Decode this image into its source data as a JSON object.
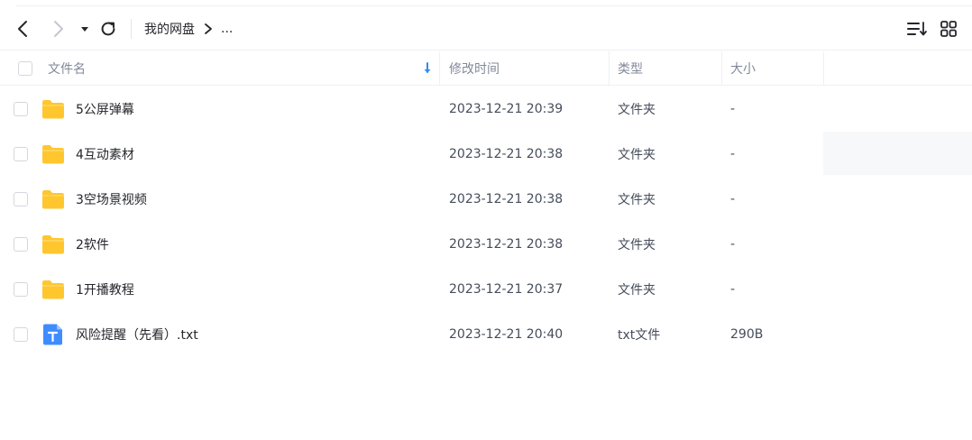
{
  "toolbar": {
    "breadcrumb": {
      "root": "我的网盘",
      "ellipsis": "..."
    }
  },
  "header": {
    "name": "文件名",
    "time": "修改时间",
    "type": "类型",
    "size": "大小"
  },
  "files": [
    {
      "name": "5公屏弹幕",
      "time": "2023-12-21 20:39",
      "type": "文件夹",
      "size": "-",
      "icon": "folder-icon"
    },
    {
      "name": "4互动素材",
      "time": "2023-12-21 20:38",
      "type": "文件夹",
      "size": "-",
      "icon": "folder-icon"
    },
    {
      "name": "3空场景视频",
      "time": "2023-12-21 20:38",
      "type": "文件夹",
      "size": "-",
      "icon": "folder-icon"
    },
    {
      "name": "2软件",
      "time": "2023-12-21 20:38",
      "type": "文件夹",
      "size": "-",
      "icon": "folder-icon"
    },
    {
      "name": "1开播教程",
      "time": "2023-12-21 20:37",
      "type": "文件夹",
      "size": "-",
      "icon": "folder-icon"
    },
    {
      "name": "风险提醒（先看）.txt",
      "time": "2023-12-21 20:40",
      "type": "txt文件",
      "size": "290B",
      "icon": "txt-file-icon"
    }
  ],
  "colors": {
    "folder": "#ffc62e",
    "txt_icon": "#3f8cff",
    "sort_arrow": "#2f8cf3"
  }
}
